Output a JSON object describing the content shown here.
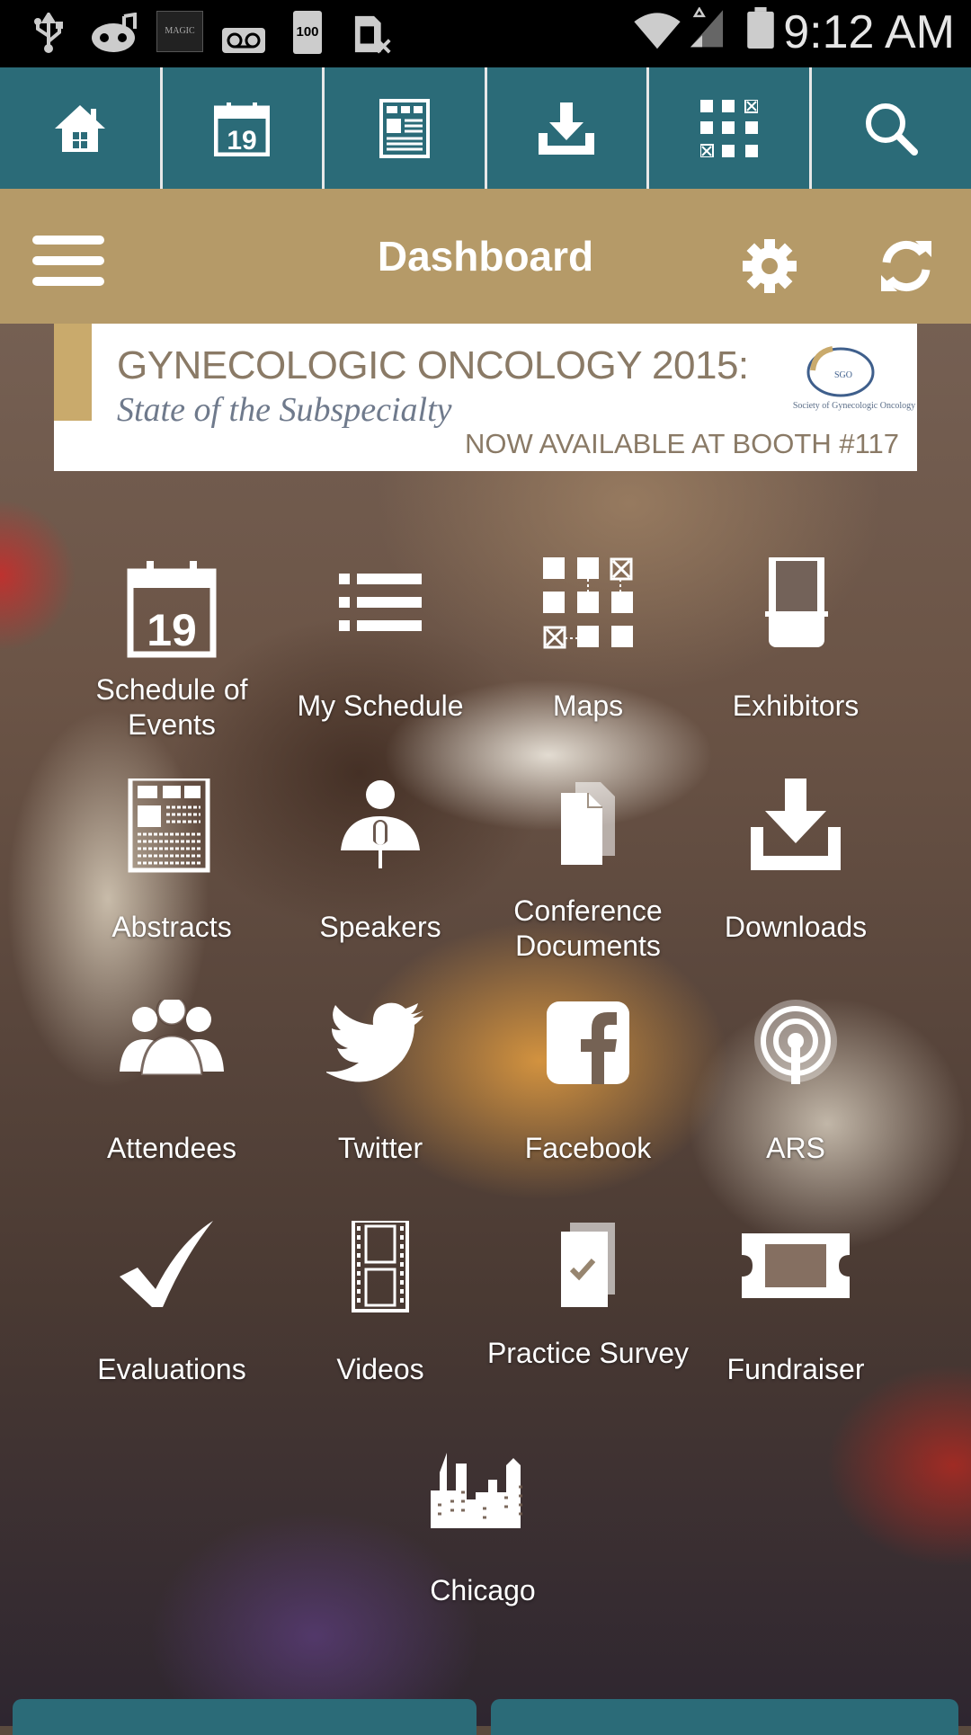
{
  "status_bar": {
    "time": "9:12 AM",
    "battery_text": "100",
    "magic_text": "MAGIC"
  },
  "top_nav": {
    "items": [
      {
        "icon": "home-icon"
      },
      {
        "icon": "calendar-icon",
        "text": "19"
      },
      {
        "icon": "abstracts-icon"
      },
      {
        "icon": "download-icon"
      },
      {
        "icon": "map-icon"
      },
      {
        "icon": "search-icon"
      }
    ]
  },
  "header": {
    "title": "Dashboard"
  },
  "banner": {
    "line1": "GYNECOLOGIC ONCOLOGY 2015:",
    "line2": "State of the Subspecialty",
    "line3": "NOW AVAILABLE AT BOOTH #117",
    "logo_text": "Society of Gynecologic Oncology",
    "logo_mark": "SGO"
  },
  "dashboard": {
    "calendar_day": "19",
    "items": [
      {
        "label": "Schedule of Events",
        "icon": "calendar-icon"
      },
      {
        "label": "My Schedule",
        "icon": "list-icon"
      },
      {
        "label": "Maps",
        "icon": "map-icon"
      },
      {
        "label": "Exhibitors",
        "icon": "booth-icon"
      },
      {
        "label": "Abstracts",
        "icon": "abstracts-icon"
      },
      {
        "label": "Speakers",
        "icon": "speaker-icon"
      },
      {
        "label": "Conference Documents",
        "icon": "documents-icon"
      },
      {
        "label": "Downloads",
        "icon": "download-icon"
      },
      {
        "label": "Attendees",
        "icon": "people-icon"
      },
      {
        "label": "Twitter",
        "icon": "twitter-icon"
      },
      {
        "label": "Facebook",
        "icon": "facebook-icon"
      },
      {
        "label": "ARS",
        "icon": "ars-icon"
      },
      {
        "label": "Evaluations",
        "icon": "checkmark-icon"
      },
      {
        "label": "Videos",
        "icon": "film-icon"
      },
      {
        "label": "Practice Survey",
        "icon": "survey-icon"
      },
      {
        "label": "Fundraiser",
        "icon": "ticket-icon"
      },
      {
        "label": "Chicago",
        "icon": "city-icon"
      }
    ]
  },
  "colors": {
    "nav_teal": "#2b6b78",
    "header_gold": "#b59a68"
  }
}
